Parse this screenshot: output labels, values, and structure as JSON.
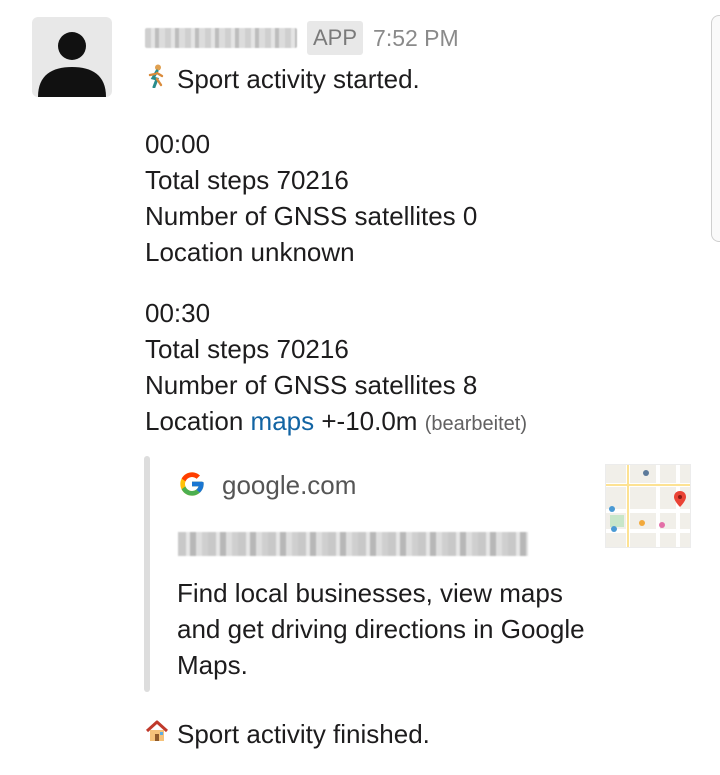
{
  "message": {
    "app_badge": "APP",
    "timestamp": "7:52 PM",
    "lines": [
      "Sport activity started.",
      "00:00",
      "Total steps 70216",
      "Number of GNSS satellites 0",
      "Location unknown",
      "00:30",
      "Total steps 70216",
      "Number of GNSS satellites 8"
    ],
    "location_prefix": "Location",
    "location_link": "maps",
    "location_suffix": "+-10.0m",
    "edited_label": "(bearbeitet)",
    "finished": "Sport activity finished."
  },
  "preview": {
    "domain": "google.com",
    "description": "Find local businesses, view maps and get driving directions in Google Maps."
  },
  "icons": {
    "start": "running-person-icon",
    "finish": "house-icon",
    "avatar": "user-avatar-icon",
    "site": "google-g-icon",
    "thumbnail": "map-thumbnail"
  },
  "colors": {
    "link": "#1264a3",
    "badge_bg": "#e8e8e8",
    "preview_bar": "#dddddd"
  }
}
